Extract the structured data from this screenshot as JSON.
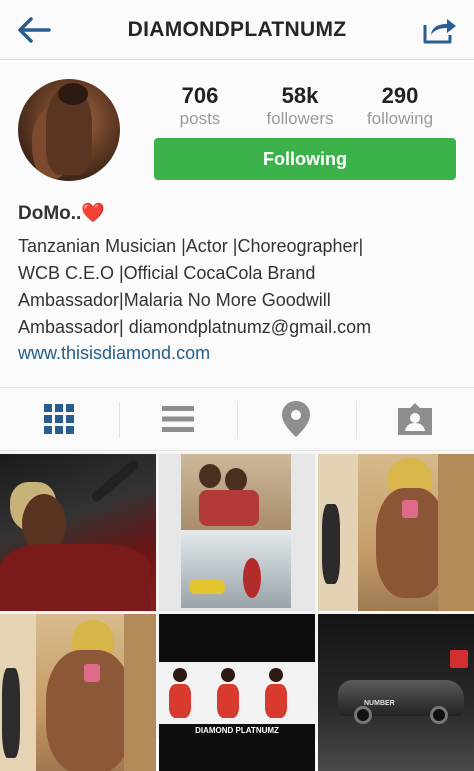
{
  "header": {
    "title": "DIAMONDPLATNUMZ",
    "back_icon": "back-arrow-icon",
    "share_icon": "share-icon"
  },
  "profile": {
    "stats": [
      {
        "value": "706",
        "label": "posts"
      },
      {
        "value": "58k",
        "label": "followers"
      },
      {
        "value": "290",
        "label": "following"
      }
    ],
    "follow_button": "Following",
    "name": "DoMo..",
    "name_emoji": "❤️",
    "bio": [
      "Tanzanian Musician |Actor |Choreographer|",
      "WCB C.E.O |Official CocaCola Brand",
      "Ambassador|Malaria No More Goodwill",
      "Ambassador| diamondplatnumz@gmail.com"
    ],
    "website": "www.thisisdiamond.com"
  },
  "tabs": [
    {
      "icon": "grid-view-icon",
      "active": true
    },
    {
      "icon": "list-view-icon",
      "active": false
    },
    {
      "icon": "location-pin-icon",
      "active": false
    },
    {
      "icon": "tagged-photos-icon",
      "active": false
    }
  ],
  "grid": {
    "photo5_caption": "DIAMOND PLATNUMZ",
    "photo6_caption": "NUMBER"
  },
  "colors": {
    "follow_green": "#3cb34a",
    "link_blue": "#255e8a",
    "icon_blue": "#2a5d8f",
    "icon_gray": "#8e8e8e"
  }
}
